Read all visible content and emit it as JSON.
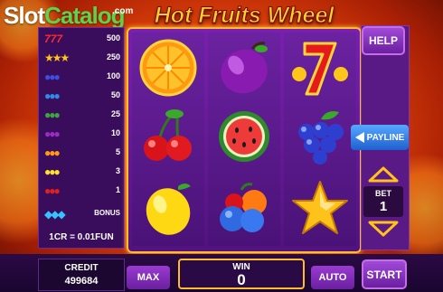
{
  "watermark": {
    "part1": "Slot",
    "part2": "Catalog",
    "suffix": ".com"
  },
  "title": "Hot Fruits Wheel",
  "paytable": {
    "rows": [
      {
        "symbol": "seven-icon",
        "glyphs": "7 7 7",
        "value": "500"
      },
      {
        "symbol": "star-icon",
        "glyphs": "★★★",
        "value": "250"
      },
      {
        "symbol": "grapes-icon",
        "glyphs": "●●●",
        "value": "100"
      },
      {
        "symbol": "mixed-fruit-icon",
        "glyphs": "●●●",
        "value": "50"
      },
      {
        "symbol": "watermelon-icon",
        "glyphs": "●●●",
        "value": "25"
      },
      {
        "symbol": "plum-icon",
        "glyphs": "●●●",
        "value": "10"
      },
      {
        "symbol": "orange-icon",
        "glyphs": "●●●",
        "value": "5"
      },
      {
        "symbol": "lemon-icon",
        "glyphs": "●●●",
        "value": "3"
      },
      {
        "symbol": "cherry-icon",
        "glyphs": "●●●",
        "value": "1"
      },
      {
        "symbol": "diamond-icon",
        "glyphs": "◆◆◆",
        "value": "BONUS"
      }
    ],
    "rate": "1CR = 0.01FUN"
  },
  "reels": [
    [
      "orange-icon",
      "cherry-icon",
      "lemon-icon"
    ],
    [
      "plum-icon",
      "watermelon-icon",
      "mixed-fruit-icon"
    ],
    [
      "seven-icon",
      "grapes-icon",
      "star-icon"
    ]
  ],
  "controls": {
    "help": "HELP",
    "payline": "PAYLINE",
    "bet_label": "BET",
    "bet_value": "1",
    "max": "MAX",
    "auto": "AUTO",
    "start": "START"
  },
  "credit": {
    "label": "CREDIT",
    "value": "499684"
  },
  "win": {
    "label": "WIN",
    "value": "0"
  },
  "colors": {
    "frame_gold": "#ffbd2e",
    "reel_purple": "#6b22a0",
    "payline_blue": "#3a86f0"
  }
}
